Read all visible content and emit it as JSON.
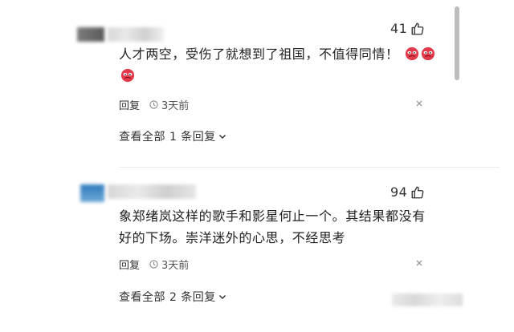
{
  "comments": [
    {
      "likes": "41",
      "text_line1": "人才两空，受伤了就想到了祖国，不值得同情！",
      "reply_label": "回复",
      "time": "3天前",
      "view_replies": "查看全部 1 条回复"
    },
    {
      "likes": "94",
      "text_line1": "象郑绪岚这样的歌手和影星何止一个。其结果都没有",
      "text_line2": "好的下场。崇洋迷外的心思，不经思考",
      "reply_label": "回复",
      "time": "3天前",
      "view_replies": "查看全部 2 条回复"
    }
  ],
  "icons": {
    "like": "thumbs-up-icon",
    "time": "clock-icon",
    "more": "more-dots-icon",
    "expand": "chevron-down-icon",
    "emoji": "angry-face-emoji"
  },
  "colors": {
    "emoji_red": "#e23a4a",
    "scrollbar": "#bdbdbd"
  }
}
